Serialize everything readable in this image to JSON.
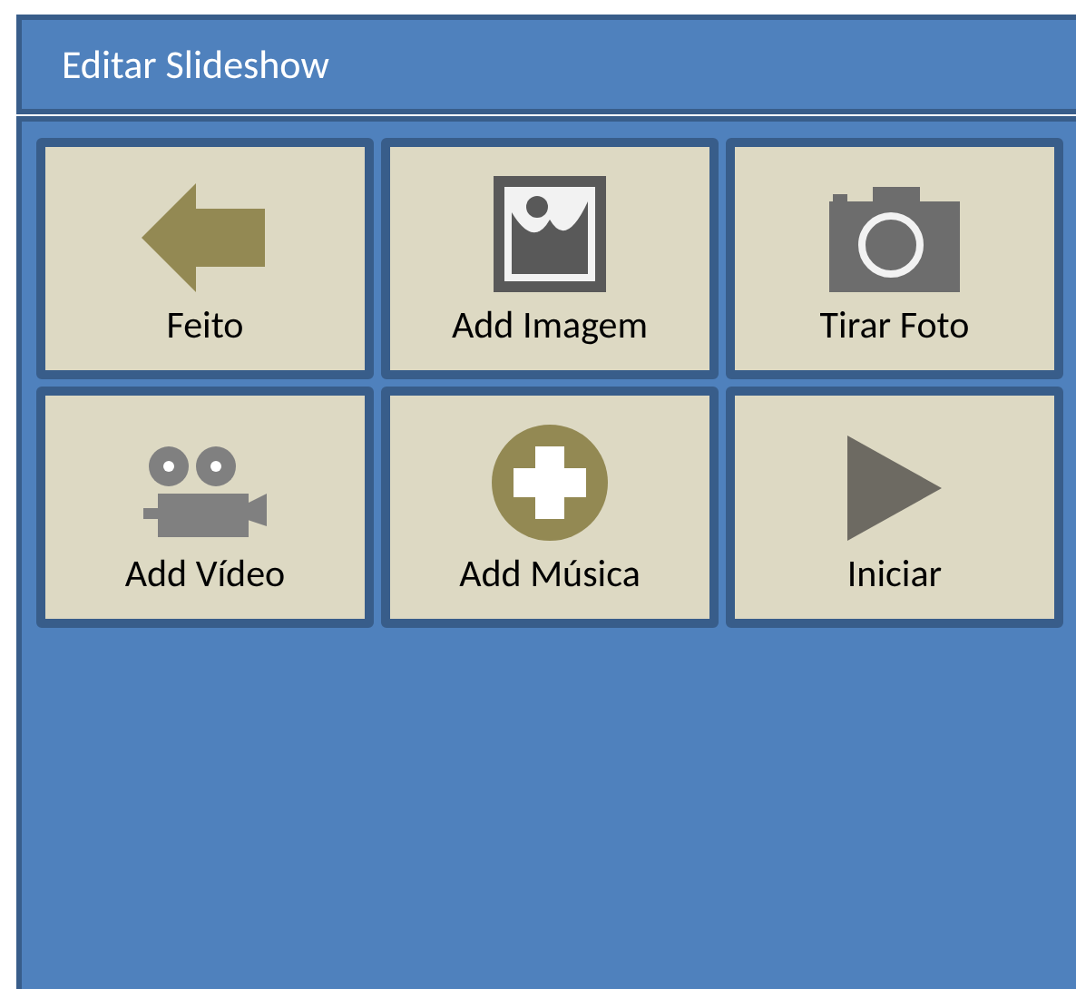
{
  "window": {
    "title": "Editar Slideshow"
  },
  "buttons": [
    {
      "kind": "back",
      "label": "Feito"
    },
    {
      "kind": "image",
      "label": "Add Imagem"
    },
    {
      "kind": "camera",
      "label": "Tirar Foto"
    },
    {
      "kind": "video",
      "label": "Add Vídeo"
    },
    {
      "kind": "add",
      "label": "Add Música"
    },
    {
      "kind": "play",
      "label": "Iniciar"
    }
  ]
}
